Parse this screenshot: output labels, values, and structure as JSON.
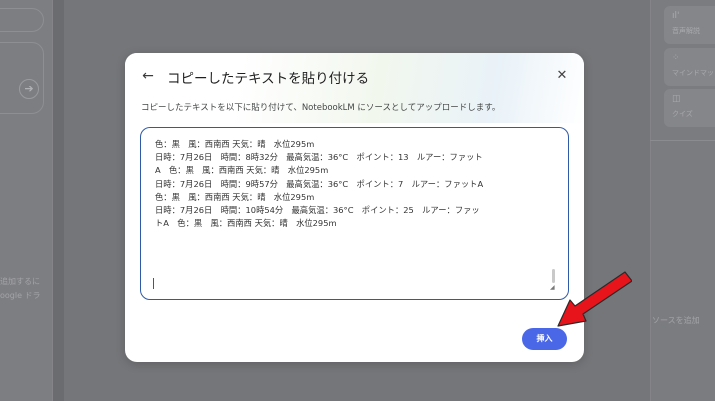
{
  "background": {
    "left_panel_text": [
      "追加するに",
      "oogle ドラ"
    ],
    "right_panel": {
      "chips": [
        {
          "icon": "audio-overview-icon",
          "label": "音声解説"
        },
        {
          "icon": "mind-map-icon",
          "label": "マインドマッ"
        },
        {
          "icon": "quiz-icon",
          "label": "クイズ"
        }
      ],
      "bottom_text": "ソースを追加"
    }
  },
  "dialog": {
    "back_icon": "←",
    "title": "コピーしたテキストを貼り付ける",
    "close_icon": "✕",
    "description": "コピーしたテキストを以下に貼り付けて、NotebookLM にソースとしてアップロードします。",
    "pasted_text": "色：黒　風：西南西 天気：晴　水位295m\n日時：7月26日　時間：8時32分　最高気温：36°C　ポイント：13　ルアー：ファット\nA　色：黒　風：西南西 天気：晴　水位295m\n日時：7月26日　時間：9時57分　最高気温：36°C　ポイント：7　ルアー：ファットA\n色：黒　風：西南西 天気：晴　水位295m\n日時：7月26日　時間：10時54分　最高気温：36°C　ポイント：25　ルアー：ファッ\nトA　色：黒　風：西南西 天気：晴　水位295m",
    "insert_label": "挿入"
  },
  "colors": {
    "accent": "#4a67e8",
    "input_border": "#2f5aa8",
    "arrow_red": "#e8141b"
  }
}
